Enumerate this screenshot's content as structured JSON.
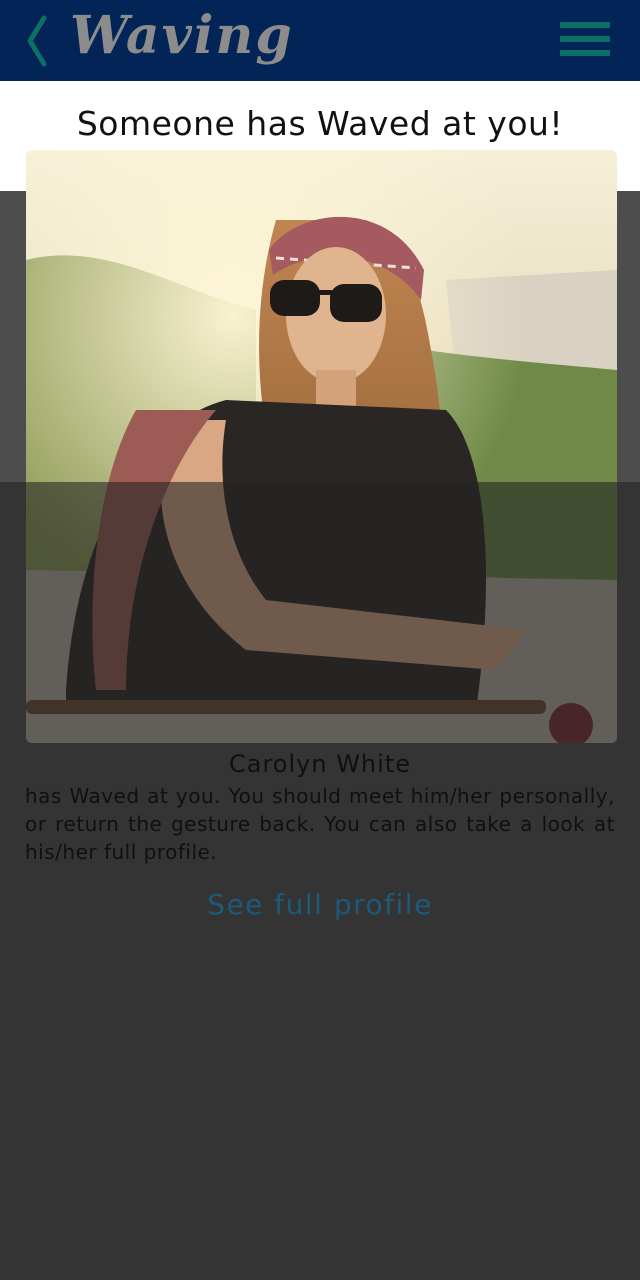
{
  "header": {
    "title": "Waving",
    "back_icon": "chevron-left-icon",
    "menu_icon": "hamburger-menu-icon"
  },
  "headline": "Someone has Waved at you!",
  "profile": {
    "name": "Carolyn White",
    "message": "has Waved at you. You should meet him/her personally, or return the gesture back. You can also take a look at his/her full profile.",
    "link_label": "See full profile"
  },
  "colors": {
    "header_bg": "#022456",
    "accent": "#0e6f66",
    "link": "#1d5a7a",
    "overlay": "#4d4d4d"
  }
}
